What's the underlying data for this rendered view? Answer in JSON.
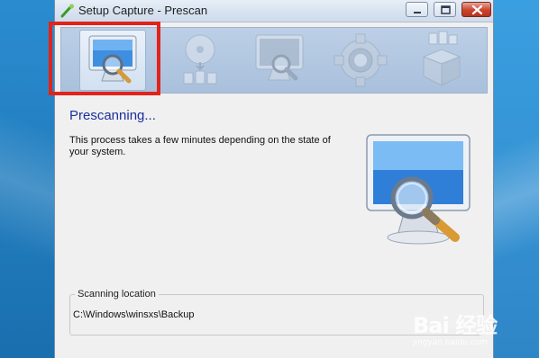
{
  "window": {
    "title": "Setup Capture - Prescan",
    "controls": [
      "minimize",
      "maximize",
      "close"
    ]
  },
  "wizard_steps": [
    {
      "icon": "monitor-magnifier-icon",
      "active": true
    },
    {
      "icon": "disc-documents-icon",
      "active": false
    },
    {
      "icon": "monitor-magnifier-icon",
      "active": false
    },
    {
      "icon": "gear-icon",
      "active": false
    },
    {
      "icon": "package-box-icon",
      "active": false
    }
  ],
  "content": {
    "heading": "Prescanning...",
    "description": "This process takes a few minutes depending on the state of your system."
  },
  "scanning": {
    "label": "Scanning location",
    "path": "C:\\Windows\\winsxs\\Backup"
  },
  "watermark": {
    "brand": "Bai 经验",
    "site": "jingyan.baidu.com"
  },
  "colors": {
    "heading": "#1a2fa0",
    "highlight": "#e2231a",
    "banner": "#a9c0dc"
  }
}
